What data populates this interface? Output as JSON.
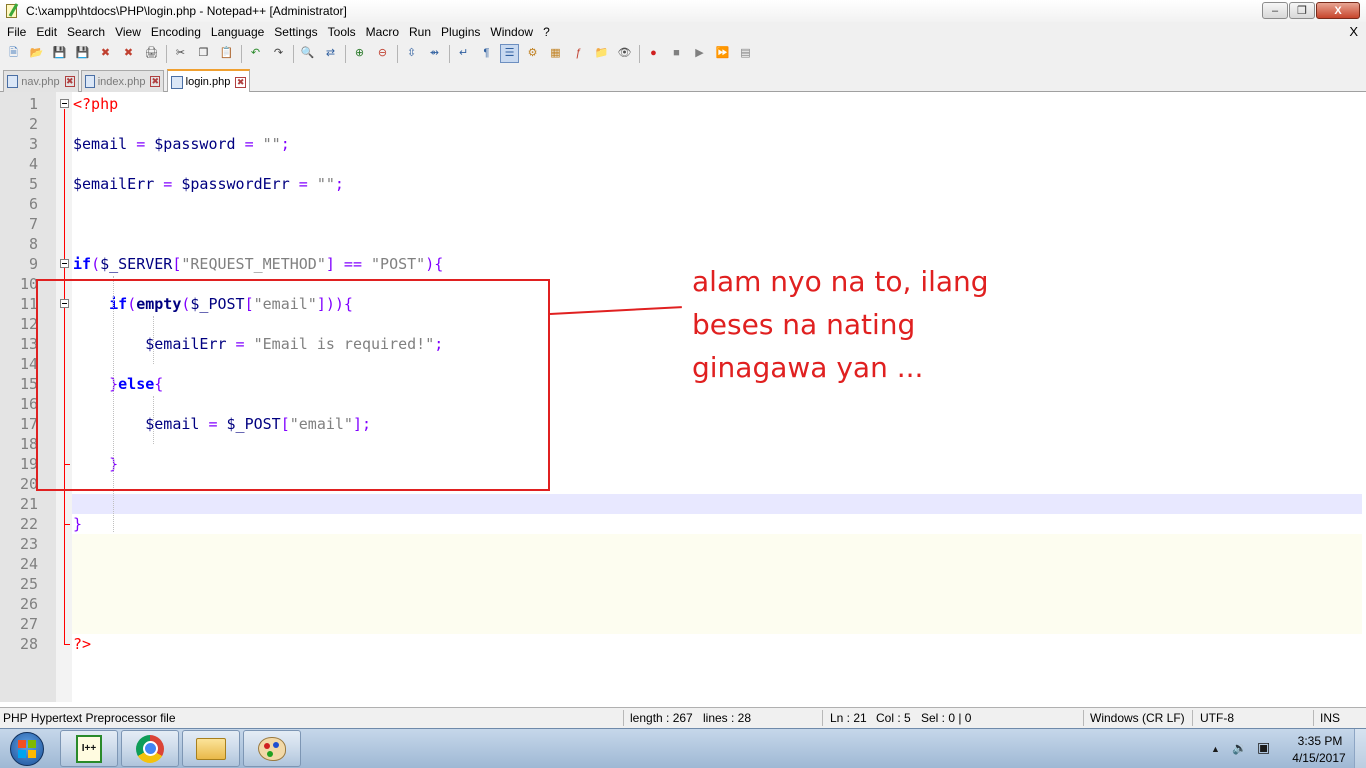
{
  "window": {
    "title": "C:\\xampp\\htdocs\\PHP\\login.php - Notepad++ [Administrator]",
    "minimize_glyph": "–",
    "maximize_glyph": "❐",
    "close_glyph": "X"
  },
  "menu": {
    "items": [
      "File",
      "Edit",
      "Search",
      "View",
      "Encoding",
      "Language",
      "Settings",
      "Tools",
      "Macro",
      "Run",
      "Plugins",
      "Window",
      "?"
    ],
    "close_doc": "X"
  },
  "toolbar": {
    "groups": [
      [
        {
          "name": "new-file-icon",
          "glyph": "🗎",
          "color": "#4a7fc0"
        },
        {
          "name": "open-file-icon",
          "glyph": "📂",
          "color": "#d8a530"
        },
        {
          "name": "save-icon",
          "glyph": "💾",
          "color": "#4a6aa0"
        },
        {
          "name": "save-all-icon",
          "glyph": "💾",
          "color": "#4a6aa0"
        },
        {
          "name": "close-file-icon",
          "glyph": "✖",
          "color": "#c04030"
        },
        {
          "name": "close-all-icon",
          "glyph": "✖",
          "color": "#c04030"
        },
        {
          "name": "print-icon",
          "glyph": "🖨",
          "color": "#505050"
        }
      ],
      [
        {
          "name": "cut-icon",
          "glyph": "✂",
          "color": "#404040"
        },
        {
          "name": "copy-icon",
          "glyph": "❐",
          "color": "#404040"
        },
        {
          "name": "paste-icon",
          "glyph": "📋",
          "color": "#a07030"
        }
      ],
      [
        {
          "name": "undo-icon",
          "glyph": "↶",
          "color": "#2a8a2a"
        },
        {
          "name": "redo-icon",
          "glyph": "↷",
          "color": "#404040"
        }
      ],
      [
        {
          "name": "find-icon",
          "glyph": "🔍",
          "color": "#404040"
        },
        {
          "name": "replace-icon",
          "glyph": "⇄",
          "color": "#3060a0"
        }
      ],
      [
        {
          "name": "zoom-in-icon",
          "glyph": "⊕",
          "color": "#2a7a2a"
        },
        {
          "name": "zoom-out-icon",
          "glyph": "⊖",
          "color": "#c04030"
        }
      ],
      [
        {
          "name": "sync-vertical-icon",
          "glyph": "⇳",
          "color": "#3060a0"
        },
        {
          "name": "sync-horizontal-icon",
          "glyph": "⇴",
          "color": "#3060a0"
        }
      ],
      [
        {
          "name": "word-wrap-icon",
          "glyph": "↵",
          "color": "#3060a0"
        },
        {
          "name": "show-all-chars-icon",
          "glyph": "¶",
          "color": "#3060a0"
        },
        {
          "name": "indent-guide-icon",
          "glyph": "☰",
          "color": "#3060a0",
          "active": true
        },
        {
          "name": "user-language-icon",
          "glyph": "⚙",
          "color": "#c08020"
        },
        {
          "name": "document-map-icon",
          "glyph": "▦",
          "color": "#c08020"
        },
        {
          "name": "function-list-icon",
          "glyph": "ƒ",
          "color": "#c04030"
        },
        {
          "name": "folder-workspace-icon",
          "glyph": "📁",
          "color": "#d8a530"
        },
        {
          "name": "monitoring-icon",
          "glyph": "👁",
          "color": "#505050"
        }
      ],
      [
        {
          "name": "record-macro-icon",
          "glyph": "●",
          "color": "#d02020"
        },
        {
          "name": "stop-macro-icon",
          "glyph": "■",
          "color": "#808080"
        },
        {
          "name": "play-macro-icon",
          "glyph": "▶",
          "color": "#808080"
        },
        {
          "name": "run-macro-multiple-icon",
          "glyph": "⏩",
          "color": "#3060c0"
        },
        {
          "name": "save-macro-icon",
          "glyph": "▤",
          "color": "#808080"
        }
      ]
    ]
  },
  "tabs": [
    {
      "label": "nav.php",
      "active": false
    },
    {
      "label": "index.php",
      "active": false
    },
    {
      "label": "login.php",
      "active": true
    }
  ],
  "tab_close_glyph": "✖",
  "editor": {
    "current_line": 21,
    "lines": [
      {
        "n": "1",
        "tokens": [
          [
            "php",
            "<?php"
          ]
        ]
      },
      {
        "n": "2",
        "tokens": []
      },
      {
        "n": "3",
        "tokens": [
          [
            "var",
            "$email"
          ],
          [
            "op",
            " = "
          ],
          [
            "var",
            "$password"
          ],
          [
            "op",
            " = "
          ],
          [
            "str",
            "\"\""
          ],
          [
            "op",
            ";"
          ]
        ]
      },
      {
        "n": "4",
        "tokens": []
      },
      {
        "n": "5",
        "tokens": [
          [
            "var",
            "$emailErr"
          ],
          [
            "op",
            " = "
          ],
          [
            "var",
            "$passwordErr"
          ],
          [
            "op",
            " = "
          ],
          [
            "str",
            "\"\""
          ],
          [
            "op",
            ";"
          ]
        ]
      },
      {
        "n": "6",
        "tokens": []
      },
      {
        "n": "7",
        "tokens": []
      },
      {
        "n": "8",
        "tokens": []
      },
      {
        "n": "9",
        "tokens": [
          [
            "kw",
            "if"
          ],
          [
            "op",
            "("
          ],
          [
            "var",
            "$_SERVER"
          ],
          [
            "op",
            "["
          ],
          [
            "str",
            "\"REQUEST_METHOD\""
          ],
          [
            "op",
            "] == "
          ],
          [
            "str",
            "\"POST\""
          ],
          [
            "op",
            "){"
          ]
        ]
      },
      {
        "n": "10",
        "tokens": []
      },
      {
        "n": "11",
        "tokens": [
          [
            "op",
            "    "
          ],
          [
            "kw",
            "if"
          ],
          [
            "op",
            "("
          ],
          [
            "fn",
            "empty"
          ],
          [
            "op",
            "("
          ],
          [
            "var",
            "$_POST"
          ],
          [
            "op",
            "["
          ],
          [
            "str",
            "\"email\""
          ],
          [
            "op",
            "])){"
          ]
        ]
      },
      {
        "n": "12",
        "tokens": []
      },
      {
        "n": "13",
        "tokens": [
          [
            "op",
            "        "
          ],
          [
            "var",
            "$emailErr"
          ],
          [
            "op",
            " = "
          ],
          [
            "str",
            "\"Email is required!\""
          ],
          [
            "op",
            ";"
          ]
        ]
      },
      {
        "n": "14",
        "tokens": []
      },
      {
        "n": "15",
        "tokens": [
          [
            "op",
            "    }"
          ],
          [
            "kw",
            "else"
          ],
          [
            "op",
            "{"
          ]
        ]
      },
      {
        "n": "16",
        "tokens": []
      },
      {
        "n": "17",
        "tokens": [
          [
            "op",
            "        "
          ],
          [
            "var",
            "$email"
          ],
          [
            "op",
            " = "
          ],
          [
            "var",
            "$_POST"
          ],
          [
            "op",
            "["
          ],
          [
            "str",
            "\"email\""
          ],
          [
            "op",
            "];"
          ]
        ]
      },
      {
        "n": "18",
        "tokens": []
      },
      {
        "n": "19",
        "tokens": [
          [
            "op",
            "    }"
          ]
        ]
      },
      {
        "n": "20",
        "tokens": []
      },
      {
        "n": "21",
        "tokens": []
      },
      {
        "n": "22",
        "tokens": [
          [
            "op",
            "}"
          ]
        ]
      },
      {
        "n": "23",
        "tokens": []
      },
      {
        "n": "24",
        "tokens": []
      },
      {
        "n": "25",
        "tokens": []
      },
      {
        "n": "26",
        "tokens": []
      },
      {
        "n": "27",
        "tokens": []
      },
      {
        "n": "28",
        "tokens": [
          [
            "php",
            "?>"
          ]
        ]
      }
    ]
  },
  "annotation": {
    "lines": [
      "alam nyo na to, ilang",
      "beses na nating",
      "ginagawa yan ..."
    ],
    "color": "#e02020"
  },
  "statusbar": {
    "file_type": "PHP Hypertext Preprocessor file",
    "length": "length : 267",
    "lines": "lines : 28",
    "ln": "Ln : 21",
    "col": "Col : 5",
    "sel": "Sel : 0 | 0",
    "eol": "Windows (CR LF)",
    "encoding": "UTF-8",
    "mode": "INS"
  },
  "taskbar": {
    "npp_icon_text": "I++",
    "tray_arrow": "▲",
    "volume_glyph": "🔉",
    "network_glyph": "▣",
    "time": "3:35 PM",
    "date": "4/15/2017"
  },
  "colors": {
    "php_tag": "#ff0000",
    "variable": "#000080",
    "operator": "#8000ff",
    "string": "#808080",
    "keyword": "#0000ff",
    "current_line": "#e8e8ff"
  }
}
